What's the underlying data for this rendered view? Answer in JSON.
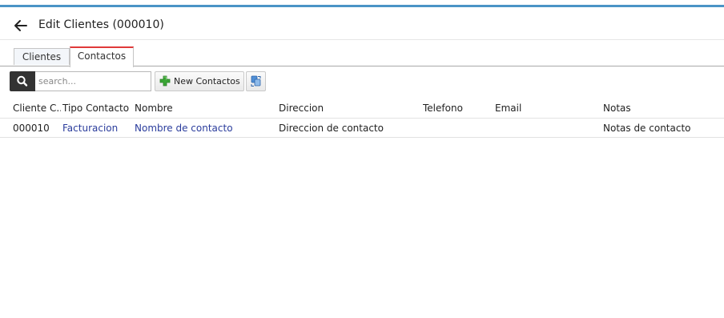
{
  "window": {
    "title": "Edit Clientes (000010)"
  },
  "icons": {
    "back": "arrow-left-icon",
    "search": "search-icon",
    "new": "plus-icon",
    "refresh": "refresh-icon"
  },
  "colors": {
    "accent_bar": "#4a94c6",
    "active_tab_border": "#e03a3a",
    "link": "#2a3c9c",
    "search_icon_bg": "#333333",
    "plus_green": "#3aa635"
  },
  "tabs": [
    {
      "label": "Clientes",
      "active": false
    },
    {
      "label": "Contactos",
      "active": true
    }
  ],
  "toolbar": {
    "search_placeholder": "search...",
    "search_value": "",
    "new_label": "New Contactos"
  },
  "table": {
    "columns": [
      "Cliente C...",
      "Tipo Contacto",
      "Nombre",
      "Direccion",
      "Telefono",
      "Email",
      "Notas"
    ],
    "rows": [
      [
        "000010",
        "Facturacion",
        "Nombre de contacto",
        "Direccion de contacto",
        "",
        "",
        "Notas de contacto"
      ]
    ]
  }
}
